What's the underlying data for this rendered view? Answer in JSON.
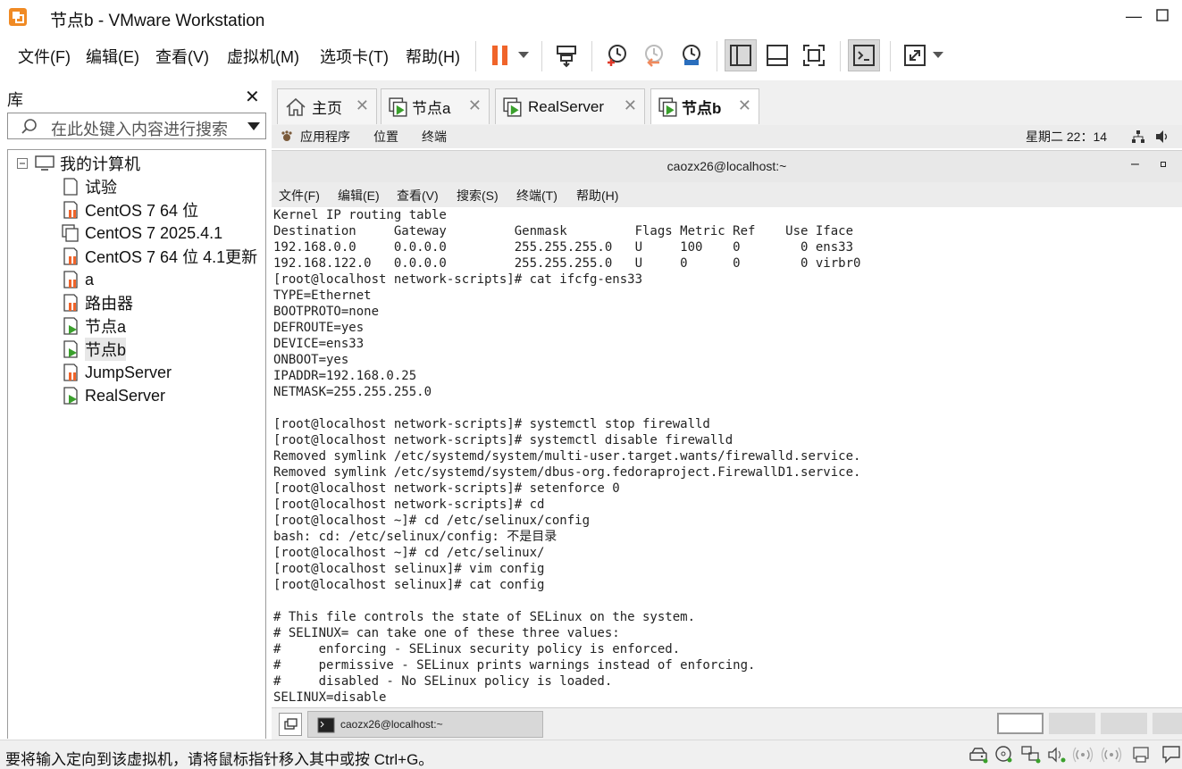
{
  "window": {
    "title": "节点b - VMware Workstation",
    "minimize_icon": "minimize-icon",
    "maximize_icon": "maximize-icon"
  },
  "menu": {
    "items": [
      "文件(F)",
      "编辑(E)",
      "查看(V)",
      "虚拟机(M)",
      "选项卡(T)",
      "帮助(H)"
    ]
  },
  "toolbar": {
    "icons": [
      "pause-icon",
      "dropdown-icon",
      "send-keys-icon",
      "snapshot-icon",
      "revert-snapshot-icon",
      "snapshot-manager-icon",
      "library-view-icon",
      "thumbnail-view-icon",
      "fullscreen-icon",
      "console-view-icon",
      "stretch-icon",
      "dropdown-icon"
    ]
  },
  "library": {
    "title": "库",
    "search_placeholder": "在此处键入内容进行搜索",
    "root": "我的计算机",
    "items": [
      "试验",
      "CentOS 7 64 位",
      "CentOS 7 2025.4.1",
      "CentOS 7 64 位 4.1更新",
      "a",
      "路由器",
      "节点a",
      "节点b",
      "JumpServer",
      "RealServer"
    ],
    "selected": "节点b"
  },
  "tabs": [
    {
      "label": "主页",
      "icon": "home-icon"
    },
    {
      "label": "节点a",
      "icon": "vm-running-icon"
    },
    {
      "label": "RealServer",
      "icon": "vm-running-icon"
    },
    {
      "label": "节点b",
      "icon": "vm-running-icon",
      "active": true
    }
  ],
  "guest": {
    "topbar": {
      "apps": "应用程序",
      "places": "位置",
      "terminal": "终端",
      "clock": "星期二 22：14"
    },
    "terminal": {
      "title": "caozx26@localhost:~",
      "menu": [
        "文件(F)",
        "编辑(E)",
        "查看(V)",
        "搜索(S)",
        "终端(T)",
        "帮助(H)"
      ],
      "lines": [
        "Kernel IP routing table",
        "Destination     Gateway         Genmask         Flags Metric Ref    Use Iface",
        "192.168.0.0     0.0.0.0         255.255.255.0   U     100    0        0 ens33",
        "192.168.122.0   0.0.0.0         255.255.255.0   U     0      0        0 virbr0",
        "[root@localhost network-scripts]# cat ifcfg-ens33",
        "TYPE=Ethernet",
        "BOOTPROTO=none",
        "DEFROUTE=yes",
        "DEVICE=ens33",
        "ONBOOT=yes",
        "IPADDR=192.168.0.25",
        "NETMASK=255.255.255.0",
        "",
        "[root@localhost network-scripts]# systemctl stop firewalld",
        "[root@localhost network-scripts]# systemctl disable firewalld",
        "Removed symlink /etc/systemd/system/multi-user.target.wants/firewalld.service.",
        "Removed symlink /etc/systemd/system/dbus-org.fedoraproject.FirewallD1.service.",
        "[root@localhost network-scripts]# setenforce 0",
        "[root@localhost network-scripts]# cd",
        "[root@localhost ~]# cd /etc/selinux/config",
        "bash: cd: /etc/selinux/config: 不是目录",
        "[root@localhost ~]# cd /etc/selinux/",
        "[root@localhost selinux]# vim config",
        "[root@localhost selinux]# cat config",
        "",
        "# This file controls the state of SELinux on the system.",
        "# SELINUX= can take one of these three values:",
        "#     enforcing - SELinux security policy is enforced.",
        "#     permissive - SELinux prints warnings instead of enforcing.",
        "#     disabled - No SELinux policy is loaded.",
        "SELINUX=disable"
      ]
    },
    "taskbar": {
      "window_label": "caozx26@localhost:~"
    }
  },
  "status": {
    "text": "要将输入定向到该虚拟机，请将鼠标指针移入其中或按 Ctrl+G。",
    "icons": [
      "hard-disk-icon",
      "cd-dvd-icon",
      "network-icon",
      "sound-icon",
      "usb-icon",
      "wireless-icon",
      "printer-icon",
      "message-icon"
    ]
  },
  "colors": {
    "accent_orange": "#f0642a",
    "running_green": "#3aa02c",
    "menu_underline": "#000000"
  }
}
